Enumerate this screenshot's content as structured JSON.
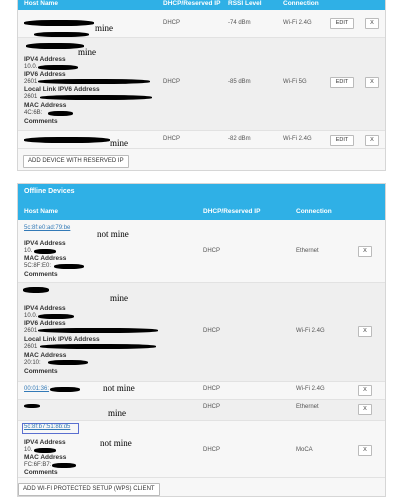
{
  "online": {
    "headers": [
      "Host Name",
      "DHCP/Reserved IP",
      "RSSI Level",
      "Connection"
    ],
    "rows": [
      {
        "name": "",
        "ip": "DHCP",
        "rssi": "-74 dBm",
        "conn": "Wi-Fi 2.4G"
      },
      {
        "name": "",
        "ipv4_label": "IPV4 Address",
        "ipv4": "10.0.",
        "ipv6_label": "IPV6 Address",
        "ipv6": "2601",
        "ll_label": "Local Link IPV6 Address",
        "ll": "2601",
        "mac_label": "MAC Address",
        "mac": "4C:6B:",
        "comments_label": "Comments",
        "ip": "DHCP",
        "rssi": "-85 dBm",
        "conn": "Wi-Fi 5G"
      },
      {
        "name": "",
        "ip": "DHCP",
        "rssi": "-82 dBm",
        "conn": "Wi-Fi 2.4G"
      }
    ],
    "edit_label": "EDIT",
    "x_label": "X",
    "add_reserved_label": "ADD DEVICE WITH RESERVED IP"
  },
  "offline": {
    "title": "Offline Devices",
    "headers": [
      "Host Name",
      "DHCP/Reserved IP",
      "Connection"
    ],
    "rows": [
      {
        "name": "5c:8f:e0:ad:79:be",
        "ipv4_label": "IPV4 Address",
        "ipv4": "10.",
        "mac_label": "MAC Address",
        "mac": "5C:8F:E0:",
        "comments_label": "Comments",
        "ip": "DHCP",
        "conn": "Ethernet"
      },
      {
        "name": "",
        "ipv4_label": "IPV4 Address",
        "ipv4": "10.0.",
        "ipv6_label": "IPV6 Address",
        "ipv6": "2601",
        "ll_label": "Local Link IPV6 Address",
        "ll": "2601",
        "mac_label": "MAC Address",
        "mac": "20:10:",
        "comments_label": "Comments",
        "ip": "DHCP",
        "conn": "Wi-Fi 2.4G"
      },
      {
        "name": "00:01:36:",
        "ip": "DHCP",
        "conn": "Wi-Fi 2.4G"
      },
      {
        "name": "",
        "ip": "DHCP",
        "conn": "Ethernet"
      },
      {
        "name": "5c:8f:b7:51:8b:d5",
        "ipv4_label": "IPV4 Address",
        "ipv4": "10.",
        "mac_label": "MAC Address",
        "mac": "FC:6F:B7:",
        "comments_label": "Comments",
        "ip": "DHCP",
        "conn": "MoCA"
      }
    ],
    "x_label": "X",
    "add_wps_label": "ADD WI-FI PROTECTED SETUP (WPS) CLIENT"
  },
  "annotations": {
    "mine": "mine",
    "not_mine": "not mine"
  }
}
